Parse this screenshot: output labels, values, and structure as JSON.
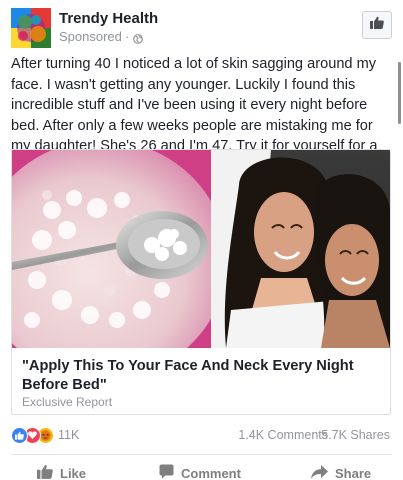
{
  "post": {
    "page_name": "Trendy Health",
    "sponsored_label": "Sponsored",
    "meta_separator": "·",
    "body_text": "After turning 40 I noticed a lot of skin sagging around my face. I wasn't getting any younger. Luckily I found this incredible stuff and I've been using it every night before bed. After only a few weeks people are mistaking me for my daughter! She's 26 and I'm 47. Try it for yourself for a younger look."
  },
  "link": {
    "title": "\"Apply This To Your Face And Neck Every Night Before Bed\"",
    "source": "Exclusive Report"
  },
  "stats": {
    "reaction_count": "11K",
    "comments": "1.4K Comments",
    "shares": "5.7K Shares"
  },
  "actions": {
    "like": "Like",
    "comment": "Comment",
    "share": "Share"
  },
  "colors": {
    "like_blue": "#3b82f6",
    "love_red": "#f33e58",
    "angry_yellow": "#f0ba15",
    "secondary_text": "#90949c",
    "action_gray": "#7f7f7f"
  },
  "icons": {
    "avatar": "page-logo-avatar",
    "globe": "globe-icon",
    "like_page": "thumbs-up-icon",
    "comment": "speech-bubble-icon",
    "share": "share-arrow-icon"
  }
}
